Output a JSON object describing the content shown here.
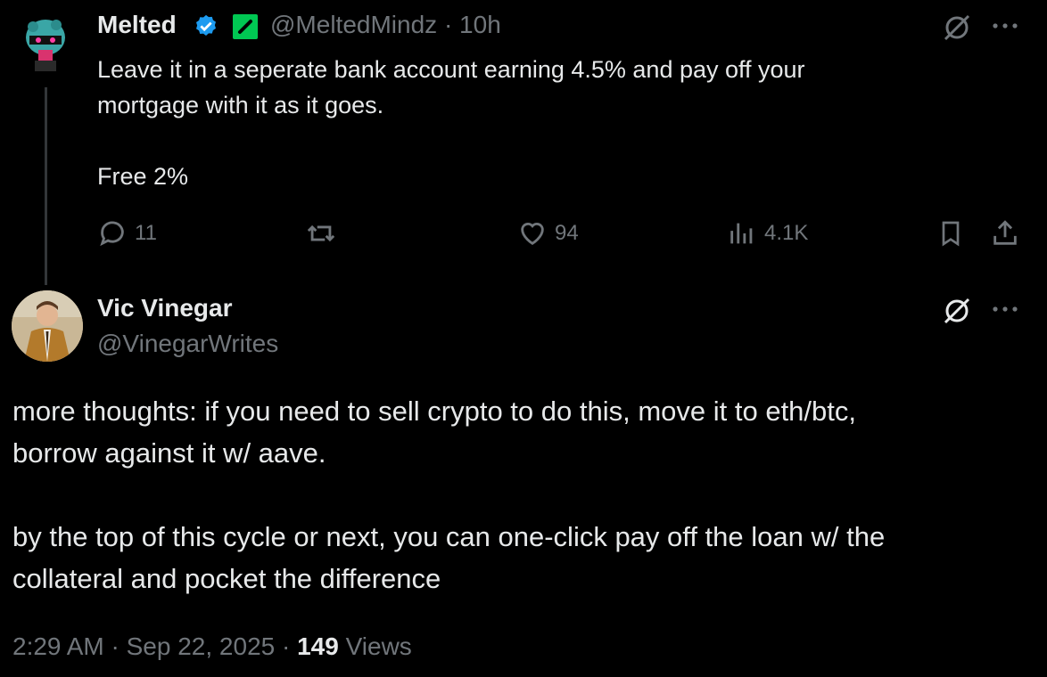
{
  "reply_tweet": {
    "author_name": "Melted",
    "verified_icon": "verified-badge-icon",
    "affiliate_icon": "green-lightning-badge-icon",
    "handle": "@MeltedMindz",
    "separator": "·",
    "time": "10h",
    "text": "Leave it in a seperate bank account earning 4.5% and pay off your\nmortgage with it as it goes.\n\nFree 2%",
    "actions": {
      "replies": "11",
      "reposts": "",
      "likes": "94",
      "views": "4.1K"
    }
  },
  "main_tweet": {
    "author_name": "Vic Vinegar",
    "handle": "@VinegarWrites",
    "text": "more thoughts: if you need to sell crypto to do this, move it to eth/btc,\nborrow against it w/ aave.\n\nby the top of this cycle or next, you can one-click pay off the loan w/ the\ncollateral and pocket the difference",
    "footer": {
      "time": "2:29 AM",
      "sep1": "·",
      "date": "Sep 22, 2025",
      "sep2": "·",
      "views_count": "149",
      "views_label": "Views"
    }
  },
  "colors": {
    "background": "#000000",
    "text": "#e7e9ea",
    "muted": "#71767b",
    "verified": "#1d9bf0",
    "affiliate": "#00ba7c"
  }
}
